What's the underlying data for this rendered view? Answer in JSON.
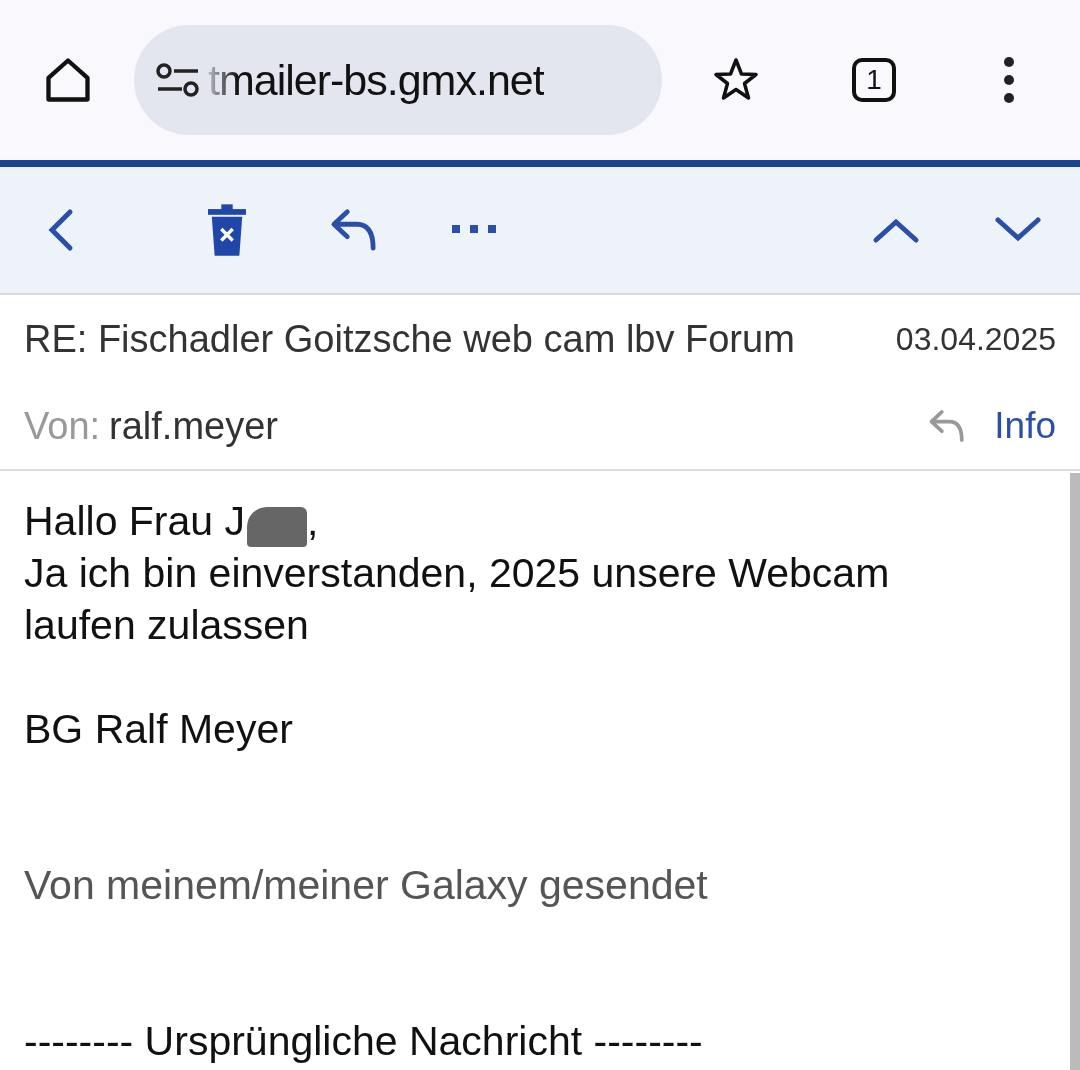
{
  "browser": {
    "url": "tmailer-bs.gmx.net",
    "tab_count": "1"
  },
  "message": {
    "subject": "RE: Fischadler Goitzsche web cam lbv Forum",
    "date": "03.04.2025",
    "from_label": "Von:",
    "from": "ralf.meyer",
    "info_link": "Info"
  },
  "body": {
    "greeting_start": "Hallo Frau J",
    "greeting_end": ",",
    "lines": [
      {
        "kind": "text",
        "text": "Ja ich bin einverstanden, 2025 unsere Webcam laufen zulassen"
      },
      {
        "kind": "blank"
      },
      {
        "kind": "text",
        "text": "BG Ralf Meyer"
      },
      {
        "kind": "blank"
      },
      {
        "kind": "blank"
      },
      {
        "kind": "muted",
        "text": "Von meinem/meiner Galaxy gesendet"
      },
      {
        "kind": "blank"
      },
      {
        "kind": "blank"
      },
      {
        "kind": "text",
        "text": "-------- Ursprüngliche Nachricht --------"
      }
    ]
  }
}
